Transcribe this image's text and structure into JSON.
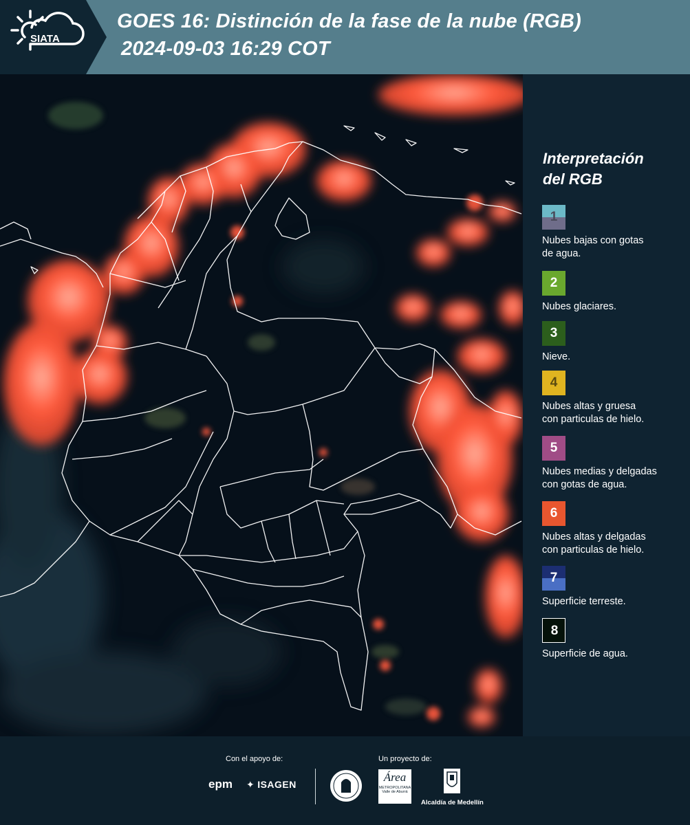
{
  "header": {
    "logo_text": "SIATA",
    "title_line1": "GOES 16: Distinción de la fase de la nube (RGB)",
    "title_line2": "2024-09-03 16:29 COT"
  },
  "legend": {
    "title_line1": "Interpretación",
    "title_line2": "del RGB",
    "items": [
      {
        "number": "1",
        "label_lines": [
          "Nubes bajas con gotas",
          "de agua."
        ],
        "colors": [
          "#6cb9c7",
          "#6f6d8a"
        ],
        "num_color": "#4a4a5a"
      },
      {
        "number": "2",
        "label_lines": [
          "Nubes glaciares."
        ],
        "colors": [
          "#6aa82e"
        ],
        "num_color": "#ffffff"
      },
      {
        "number": "3",
        "label_lines": [
          "Nieve."
        ],
        "colors": [
          "#2c5e1c"
        ],
        "num_color": "#ffffff"
      },
      {
        "number": "4",
        "label_lines": [
          "Nubes altas y gruesa",
          "con particulas de hielo."
        ],
        "colors": [
          "#e0b420"
        ],
        "num_color": "#5a4a10"
      },
      {
        "number": "5",
        "label_lines": [
          "Nubes medias y delgadas",
          "con gotas de agua."
        ],
        "colors": [
          "#a04c86"
        ],
        "num_color": "#ffffff"
      },
      {
        "number": "6",
        "label_lines": [
          "Nubes altas y delgadas",
          "con particulas de hielo."
        ],
        "colors": [
          "#e8562f"
        ],
        "num_color": "#ffffff"
      },
      {
        "number": "7",
        "label_lines": [
          "Superficie terreste."
        ],
        "colors": [
          "#1c2e72",
          "#4a6fc4"
        ],
        "num_color": "#ffffff"
      },
      {
        "number": "8",
        "label_lines": [
          "Superficie de agua."
        ],
        "colors": [
          "#05120a"
        ],
        "num_color": "#ffffff"
      }
    ]
  },
  "footer": {
    "support_caption": "Con el apoyo de:",
    "project_caption": "Un proyecto de:",
    "sponsor_epm": "epm",
    "sponsor_isagen": "ISAGEN",
    "partner_area_name": "Área",
    "partner_area_sub1": "METROPOLITANA",
    "partner_area_sub2": "Valle de Aburrá",
    "partner_alcaldia": "Alcaldía de Medellín"
  },
  "colors": {
    "header_bg": "#557e8c",
    "panel_bg": "#0f2331",
    "map_bg": "#06101a",
    "cloud_ice": "#ff5a3c",
    "border_lines": "#ffffff"
  }
}
